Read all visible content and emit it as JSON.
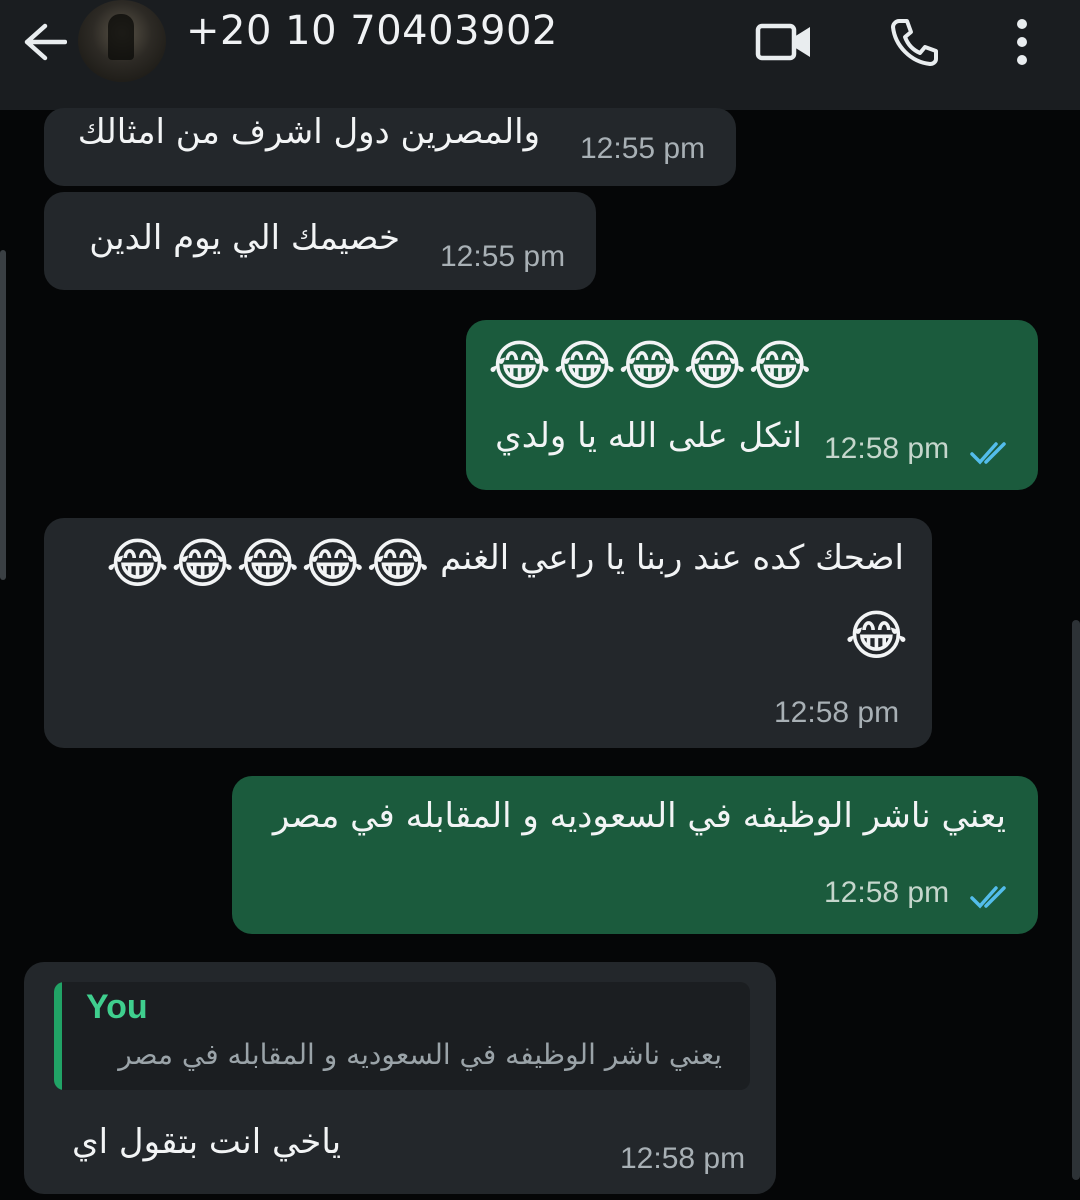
{
  "header": {
    "back_icon": "arrow-left-icon",
    "contact": "+20 10 70403902",
    "icons": [
      "video-call-icon",
      "phone-icon",
      "more-vert-icon"
    ]
  },
  "colors": {
    "incoming_bubble": "#23272b",
    "outgoing_bubble": "#1b5b3d",
    "read_ticks": "#53bdeb",
    "quote_accent": "#21a366"
  },
  "messages": [
    {
      "type": "incoming",
      "text": "والمصرين دول اشرف من امثالك",
      "time": "12:55 pm"
    },
    {
      "type": "incoming",
      "text": "خصيمك الي يوم الدين",
      "time": "12:55 pm"
    },
    {
      "type": "outgoing",
      "emoji": "😂😂😂😂😂",
      "text": "اتكل على الله يا ولدي",
      "time": "12:58 pm",
      "status": "read"
    },
    {
      "type": "incoming",
      "text": "اضحك كده عند ربنا يا راعي الغنم",
      "emoji": "😂😂😂😂😂",
      "emoji2": "😂",
      "time": "12:58 pm"
    },
    {
      "type": "outgoing",
      "text": "يعني ناشر الوظيفه في السعوديه و المقابله في مصر",
      "time": "12:58 pm",
      "status": "read"
    },
    {
      "type": "incoming",
      "quote_author": "You",
      "quote_text": "يعني ناشر الوظيفه في السعوديه و المقابله في مصر",
      "text": "ياخي انت بتقول اي",
      "time": "12:58 pm"
    }
  ]
}
